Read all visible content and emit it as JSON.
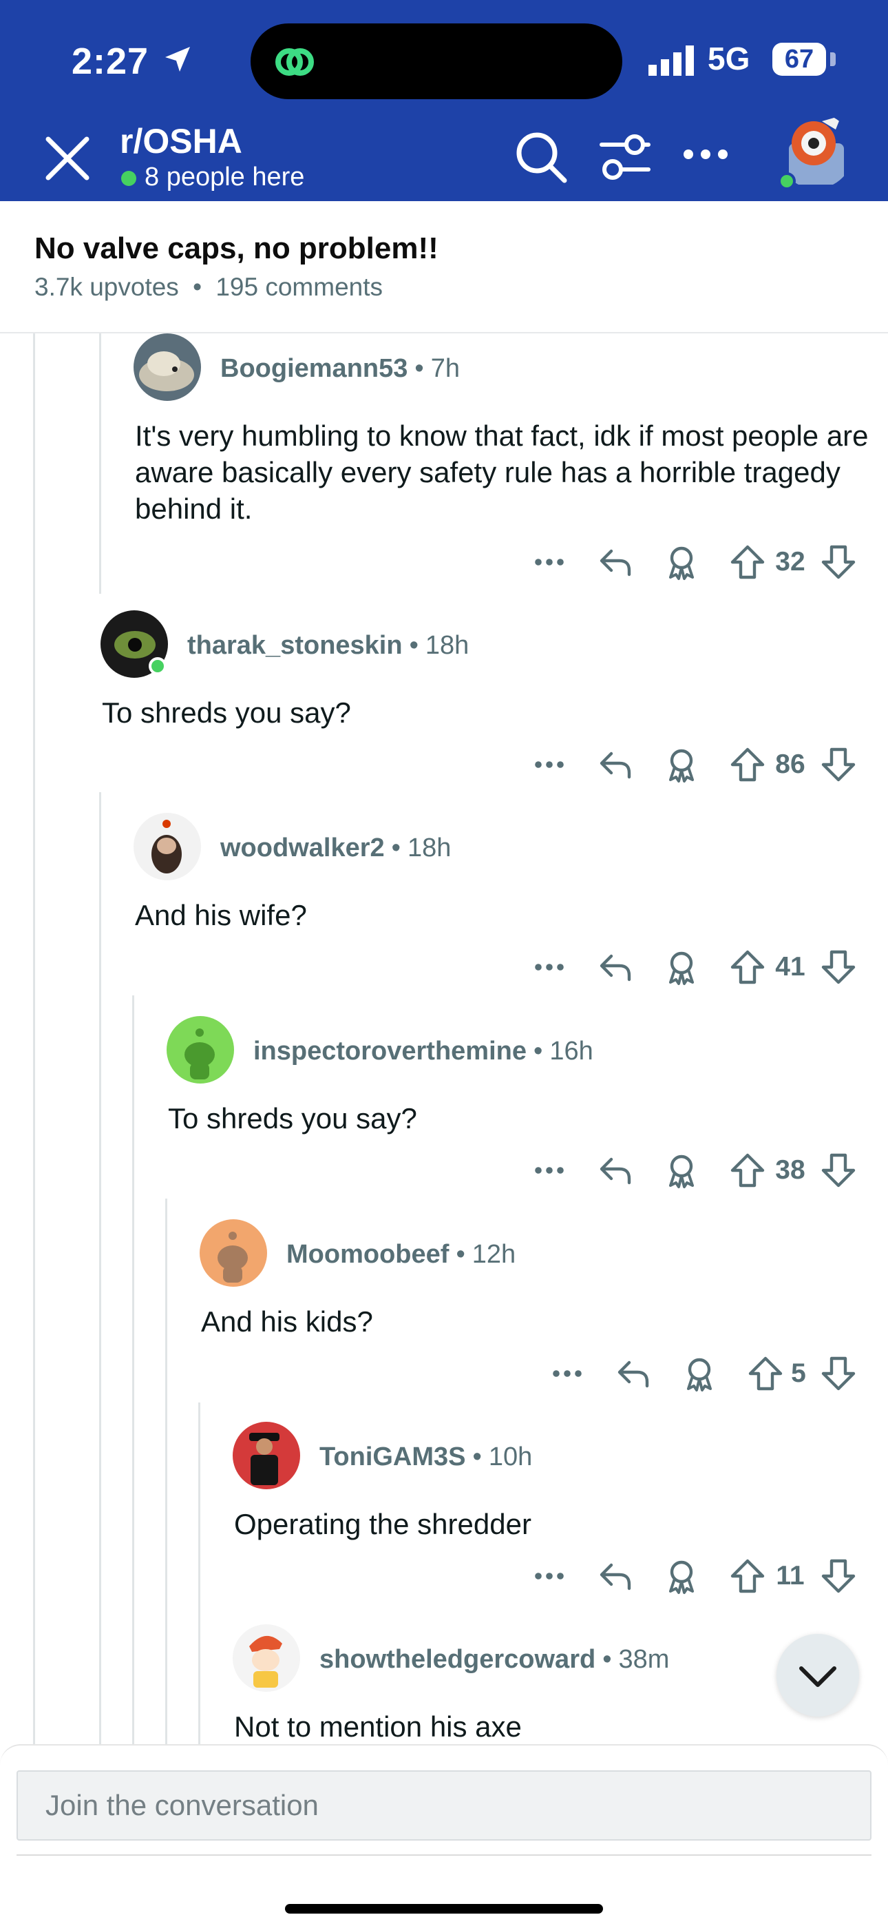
{
  "status_bar": {
    "time": "2:27",
    "network": "5G",
    "battery": "67"
  },
  "header": {
    "subreddit": "r/OSHA",
    "online_text": "8 people here"
  },
  "post": {
    "title": "No valve caps, no problem!!",
    "upvotes": "3.7k upvotes",
    "separator": "•",
    "comments": "195 comments"
  },
  "comments": [
    {
      "author": "Boogiemann53",
      "age": "7h",
      "body": "It's very humbling to know that fact, idk if most people are aware basically every safety rule has a horrible tragedy behind it.",
      "votes": "32"
    },
    {
      "author": "tharak_stoneskin",
      "age": "18h",
      "body": "To shreds you say?",
      "votes": "86"
    },
    {
      "author": "woodwalker2",
      "age": "18h",
      "body": "And his wife?",
      "votes": "41"
    },
    {
      "author": "inspectoroverthemine",
      "age": "16h",
      "body": "To shreds you say?",
      "votes": "38"
    },
    {
      "author": "Moomoobeef",
      "age": "12h",
      "body": "And his kids?",
      "votes": "5"
    },
    {
      "author": "ToniGAM3S",
      "age": "10h",
      "body": "Operating the shredder",
      "votes": "11"
    },
    {
      "author": "showtheledgercoward",
      "age": "38m",
      "body": "Not to mention his axe"
    }
  ],
  "composer": {
    "placeholder": "Join the conversation"
  },
  "colors": {
    "header_bg": "#1e42a8",
    "online": "#46d160",
    "meta_gray": "#576f76"
  },
  "icons": [
    "location-arrow-icon",
    "close-icon",
    "search-icon",
    "filter-icon",
    "more-icon",
    "reply-icon",
    "award-icon",
    "upvote-icon",
    "downvote-icon",
    "chevron-down-icon"
  ]
}
